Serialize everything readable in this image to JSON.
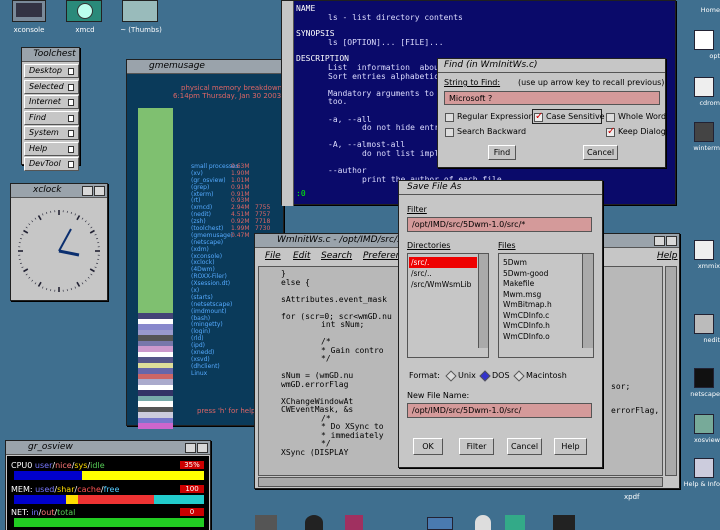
{
  "icons_top": [
    "xconsole",
    "xmcd",
    "~ (Thumbs)"
  ],
  "toolchest": {
    "title": "Toolchest",
    "items": [
      "Desktop",
      "Selected",
      "Internet",
      "Find",
      "System",
      "Help",
      "DevTool"
    ]
  },
  "xclock": {
    "title": "xclock"
  },
  "gmemusage": {
    "title": "gmemusage",
    "header": "physical memory breakdown",
    "time": "6:14pm Thursday, Jan 30 2003",
    "labels": [
      "small processes",
      "(xv)",
      "(gr_osview)",
      "(grep)",
      "(xterm)",
      "(rt)",
      "(xmcd)",
      "(nedit)",
      "(zsh)",
      "(toolchest)",
      "(gmemusage)",
      "(netscape)",
      "(xdm)",
      "(xconsole)",
      "(xclock)",
      "(4Dwm)",
      "(ROXX-Filer)",
      "(Xsession.dt)",
      "(x)",
      "(starts)",
      "(netsetscape)",
      "(imdmount)",
      "(bash)",
      "(mingetty)",
      "(login)",
      "(rld)",
      "(ipd)",
      "(xnedd)",
      "(xsvd)",
      "(dhclient)",
      "Linux"
    ],
    "values": [
      "0.63M",
      "1.90M",
      "1.01M",
      "0.91M",
      "0.91M",
      "0.93M",
      "2.94M",
      "4.51M",
      "0.92M",
      "1.99M",
      "0.47M",
      "",
      "",
      "",
      "",
      "",
      "",
      "",
      "",
      "",
      "",
      "",
      "",
      "",
      "",
      "",
      "",
      "",
      "",
      "",
      ""
    ],
    "counts": [
      "",
      "",
      "",
      "",
      "",
      "",
      "7755",
      "7757",
      "7718",
      "7730",
      "",
      "",
      "",
      "",
      "",
      "",
      "",
      "",
      "",
      "",
      "",
      "",
      "",
      "",
      "",
      "",
      "",
      "",
      "",
      "",
      ""
    ],
    "help": "press 'h' for help"
  },
  "osview": {
    "title": "gr_osview",
    "cpu_label": "CPU0",
    "cpu_legend": [
      "user",
      "nice",
      "sys",
      "idle"
    ],
    "cpu_value": "35%",
    "mem_label": "MEM:",
    "mem_legend": [
      "used",
      "shar",
      "cache",
      "free"
    ],
    "mem_value": "100",
    "net_label": "NET:",
    "net_legend": [
      "in",
      "out",
      "total"
    ],
    "net_value": "0"
  },
  "manpage": {
    "name_head": "NAME",
    "name_text": "ls - list directory contents",
    "syn_head": "SYNOPSIS",
    "syn_text": "ls [OPTION]... [FILE]...",
    "desc_head": "DESCRIPTION",
    "desc_lines": [
      "List  information  about",
      "Sort entries alphabetica",
      "",
      "Mandatory arguments to l",
      "too.",
      "",
      "-a, --all",
      "do not hide entri",
      "",
      "-A, --almost-all",
      "do not list impli",
      "",
      "--author",
      "print the author of each file"
    ],
    "prompt": ":0"
  },
  "find": {
    "title": "Find (in WmInitWs.c)",
    "string_label": "String to Find:",
    "hint": "(use up arrow key to recall previous)",
    "value": "Microsoft ?",
    "opts": [
      "Regular Expression",
      "Case Sensitive",
      "Whole Word",
      "Search Backward",
      "Keep Dialog"
    ],
    "find_btn": "Find",
    "cancel_btn": "Cancel"
  },
  "nedit": {
    "title": "WmInitWs.c - /opt/IMD/src/5Dw",
    "menus": [
      "File",
      "Edit",
      "Search",
      "Preferences",
      "Help"
    ],
    "code": [
      "}",
      "else {",
      "",
      "sAttributes.event_mask",
      "",
      "for (scr=0; scr<wmGD.nu",
      "int sNum;",
      "",
      "/*",
      "* Gain contro",
      "*/",
      "",
      "sNum = (wmGD.nu",
      "wmGD.errorFlag",
      "",
      "XChangeWindowAt",
      "CWEventMask, &s",
      "/*",
      "* Do XSync to",
      "* immediately",
      "*/",
      "XSync (DISPLAY"
    ],
    "code_right": [
      "sor;",
      "",
      "errorFlag,"
    ]
  },
  "savefile": {
    "title": "Save File As",
    "filter_label": "Filter",
    "filter_value": "/opt/IMD/src/5Dwm-1.0/src/*",
    "dirs_label": "Directories",
    "files_label": "Files",
    "dirs": [
      "/src/.",
      "/src/..",
      "/src/WmWsmLib"
    ],
    "files": [
      "5Dwm",
      "5Dwm-good",
      "Makefile",
      "Mwm.msg",
      "WmBitmap.h",
      "WmCDInfo.c",
      "WmCDInfo.h",
      "WmCDInfo.o"
    ],
    "format_label": "Format:",
    "formats": [
      "Unix",
      "DOS",
      "Macintosh"
    ],
    "newname_label": "New File Name:",
    "newname_value": "/opt/IMD/src/5Dwm-1.0/src/",
    "buttons": [
      "OK",
      "Filter",
      "Cancel",
      "Help"
    ]
  },
  "right_icons": [
    "Home",
    "opt",
    "cdrom",
    "winterm",
    "xmmix",
    "nedit",
    "netscape",
    "xosview",
    "Help & Info"
  ],
  "bottom_label": "xpdf"
}
